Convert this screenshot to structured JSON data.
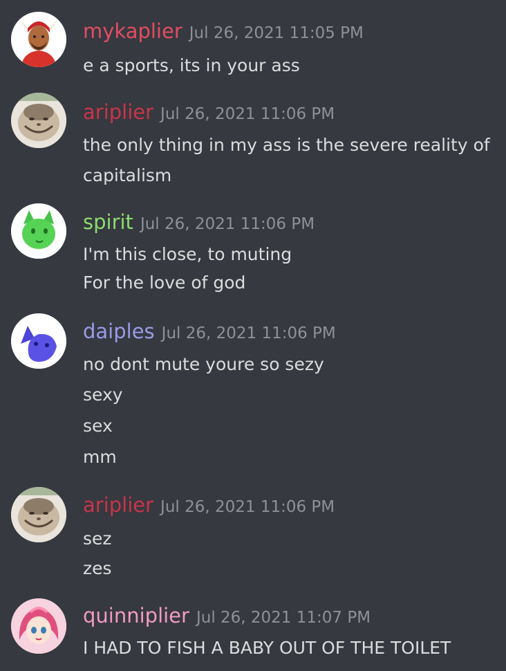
{
  "messages": [
    {
      "username": "mykaplier",
      "username_color": "#e24d62",
      "timestamp": "Jul 26, 2021 11:05 PM",
      "avatar": "horned-character-avatar",
      "lines": [
        "e a sports, its in your ass"
      ]
    },
    {
      "username": "ariplier",
      "username_color": "#c9344a",
      "timestamp": "Jul 26, 2021 11:06 PM",
      "avatar": "smiling-cat-avatar",
      "lines": [
        "the only thing in my ass is the severe reality of",
        "capitalism"
      ]
    },
    {
      "username": "spirit",
      "username_color": "#8bdc6f",
      "timestamp": "Jul 26, 2021 11:06 PM",
      "avatar": "green-cat-avatar",
      "lines": [
        "I'm this close, to muting",
        "For the love of god"
      ]
    },
    {
      "username": "daiples",
      "username_color": "#9a9ce8",
      "timestamp": "Jul 26, 2021 11:06 PM",
      "avatar": "blue-cat-avatar",
      "lines": [
        "no dont mute youre so sezy",
        "sexy",
        "sex",
        "mm"
      ]
    },
    {
      "username": "ariplier",
      "username_color": "#c9344a",
      "timestamp": "Jul 26, 2021 11:06 PM",
      "avatar": "smiling-cat-avatar",
      "lines": [
        "sez",
        "zes"
      ]
    },
    {
      "username": "quinniplier",
      "username_color": "#f09bc6",
      "timestamp": "Jul 26, 2021 11:07 PM",
      "avatar": "pink-anime-girl-avatar",
      "lines": [
        "I HAD TO FISH A BABY OUT OF THE TOILET"
      ]
    }
  ]
}
